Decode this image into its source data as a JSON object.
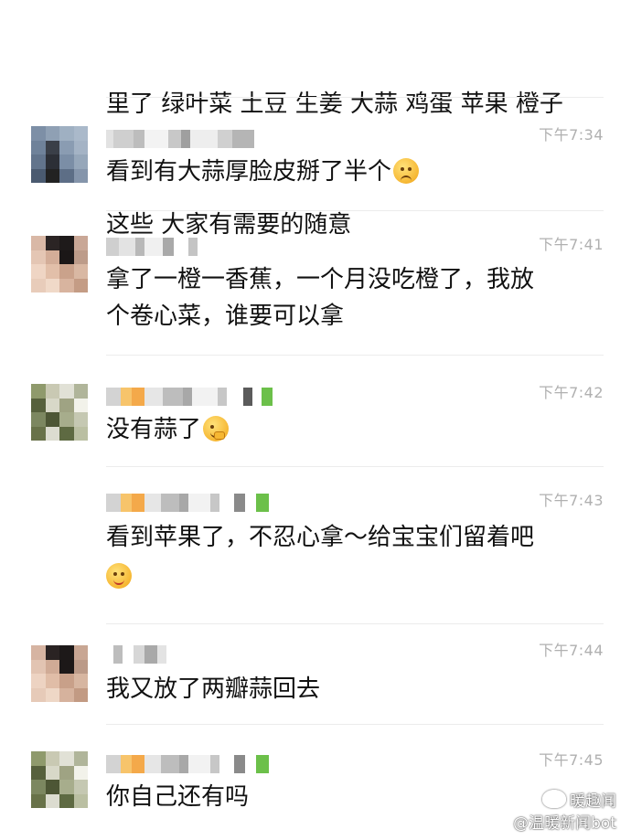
{
  "chat": {
    "top_message": {
      "lines": [
        "里了 绿叶菜 土豆 生姜 大蒜 鸡蛋 苹果 橙子",
        "这些 大家有需要的随意"
      ]
    },
    "messages": [
      {
        "time": "下午7:34",
        "text": "看到有大蒜厚脸皮掰了半个",
        "emoji": "facepalm"
      },
      {
        "time": "下午7:41",
        "text": "拿了一橙一香蕉，一个月没吃橙了，我放\n个卷心菜，谁要可以拿",
        "emoji": ""
      },
      {
        "time": "下午7:42",
        "text": "没有蒜了",
        "emoji": "hand-over-mouth"
      },
      {
        "time": "下午7:43",
        "text": "看到苹果了，不忍心拿～给宝宝们留着吧",
        "emoji": "blush"
      },
      {
        "time": "下午7:44",
        "text": "我又放了两瓣蒜回去",
        "emoji": ""
      },
      {
        "time": "下午7:45",
        "text": "你自己还有吗",
        "emoji": ""
      }
    ]
  },
  "watermark": {
    "line1": "暖趣闻",
    "line2": "@温暖新闻bot"
  },
  "colors": {
    "background": "#ffffff",
    "text": "#111111",
    "time": "#b0b0b0",
    "divider": "#ececec"
  }
}
